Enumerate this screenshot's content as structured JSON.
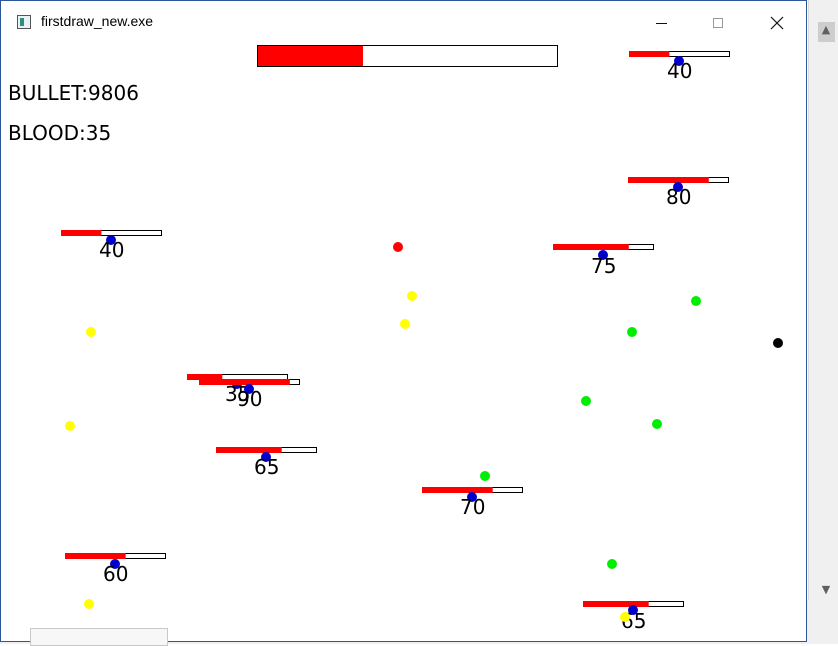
{
  "window": {
    "title": "firstdraw_new.exe",
    "controls": {
      "minimize": "minimize",
      "maximize": "maximize",
      "close": "close"
    }
  },
  "hud": {
    "bullet_label": "BULLET:9806",
    "blood_label": "BLOOD:35",
    "player_health_fraction": 0.35,
    "health_color": "#ff0000"
  },
  "enemies": [
    {
      "hp": "40",
      "fill": 0.4
    },
    {
      "hp": "80",
      "fill": 0.8
    },
    {
      "hp": "40",
      "fill": 0.4
    },
    {
      "hp": "75",
      "fill": 0.75
    },
    {
      "hp": "35",
      "fill": 0.35
    },
    {
      "hp": "90",
      "fill": 0.9
    },
    {
      "hp": "65",
      "fill": 0.65
    },
    {
      "hp": "70",
      "fill": 0.7
    },
    {
      "hp": "60",
      "fill": 0.6
    },
    {
      "hp": "65",
      "fill": 0.65
    }
  ],
  "colors": {
    "enemy_dot": "#0000cc",
    "pickup_yellow": "#ffff00",
    "pickup_green": "#00ee00",
    "bullet_red": "#ff0000",
    "player_black": "#000000"
  }
}
